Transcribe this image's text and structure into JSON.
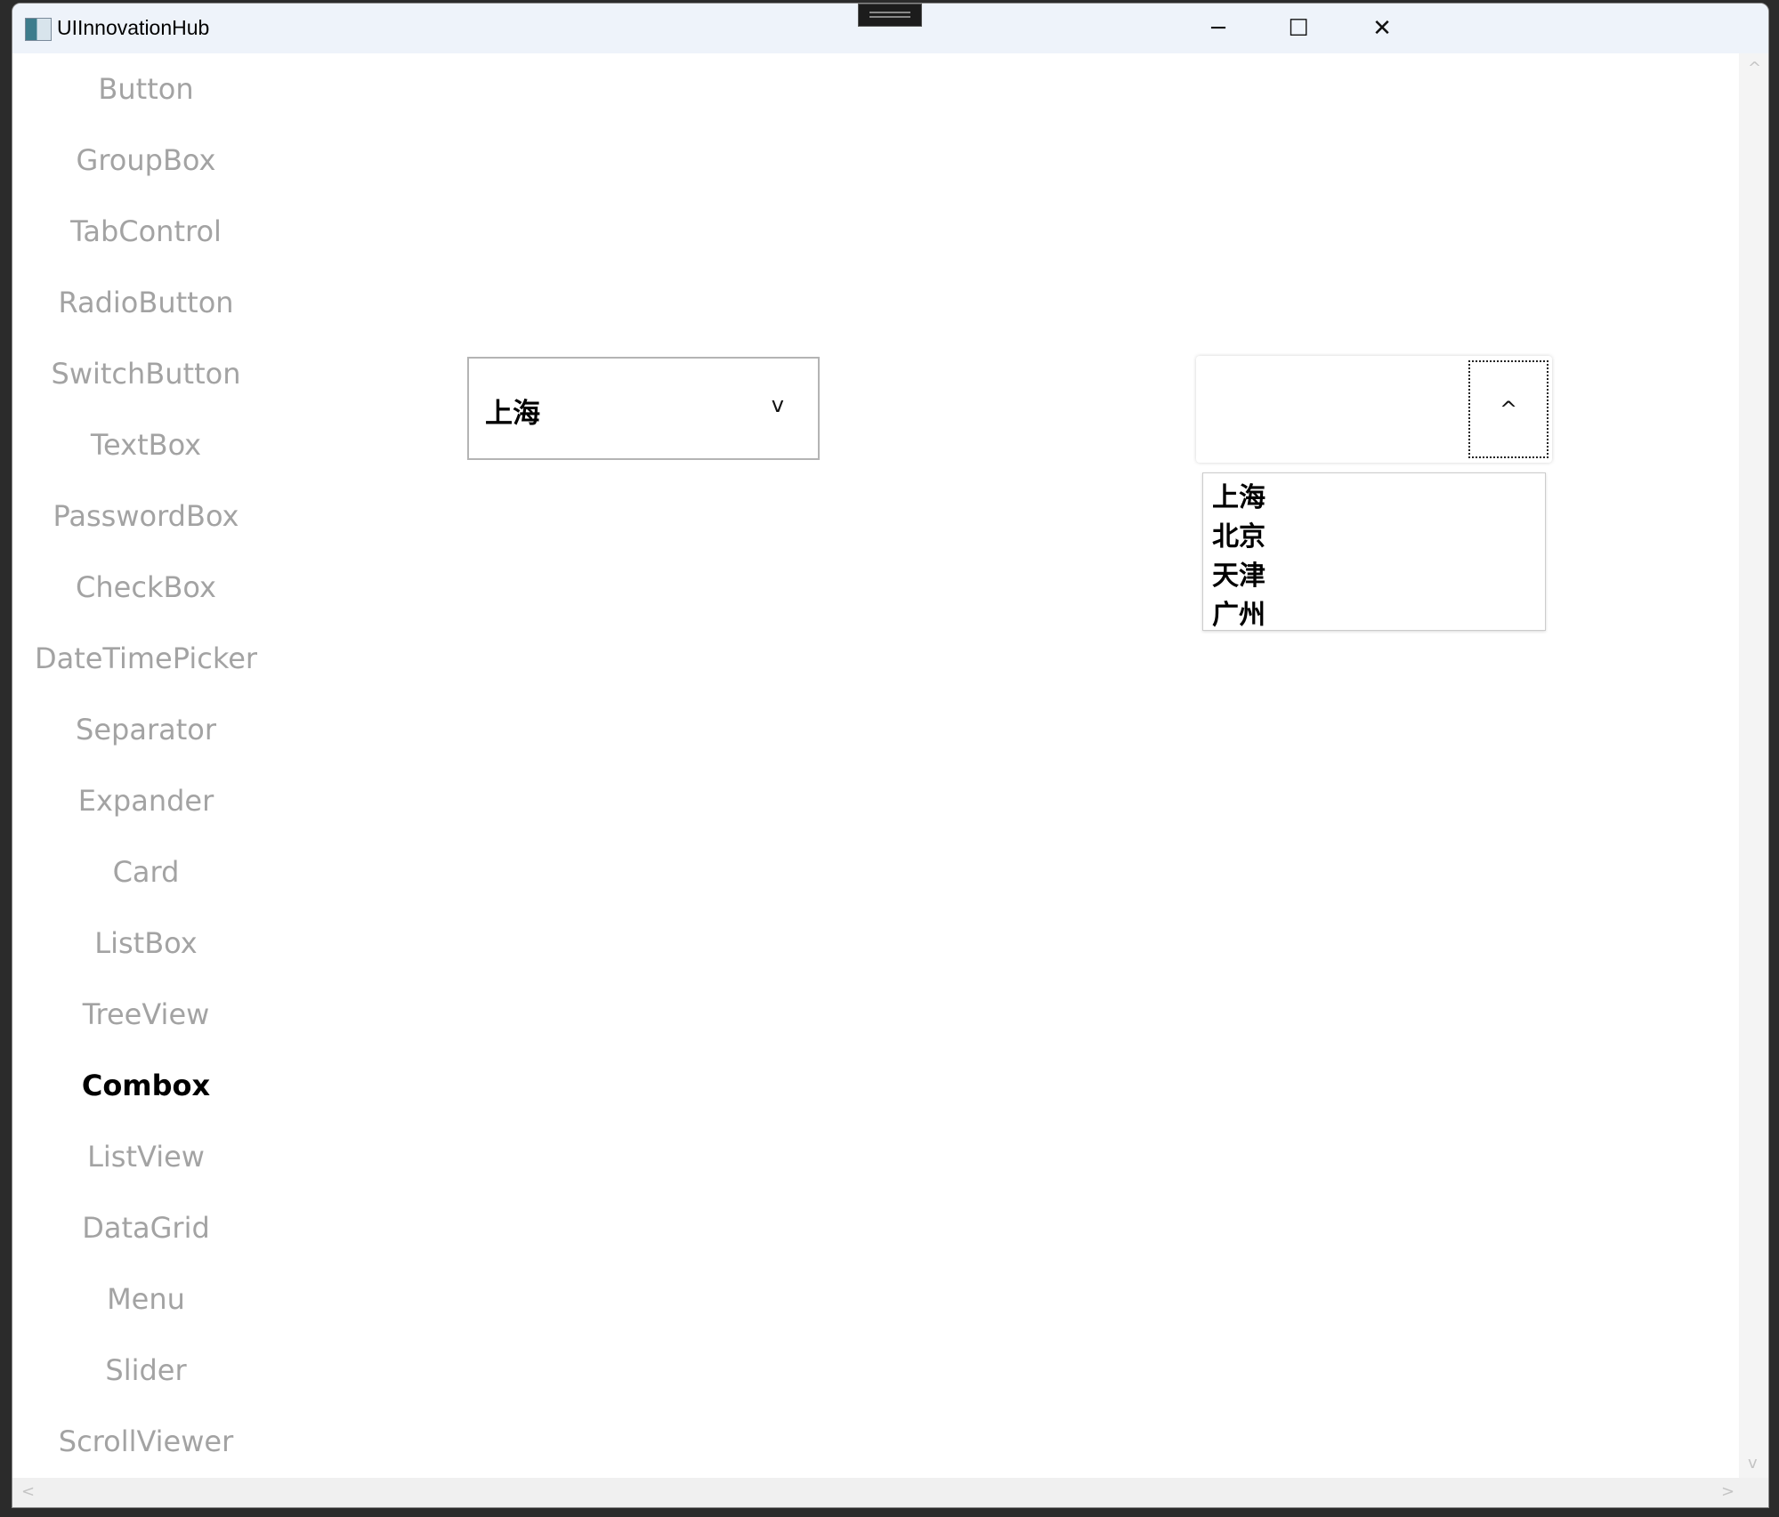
{
  "window": {
    "title": "UIInnovationHub",
    "minimize": "─",
    "maximize": "☐",
    "close": "✕"
  },
  "sidebar": {
    "items": [
      {
        "label": "Button"
      },
      {
        "label": "GroupBox"
      },
      {
        "label": "TabControl"
      },
      {
        "label": "RadioButton"
      },
      {
        "label": "SwitchButton"
      },
      {
        "label": "TextBox"
      },
      {
        "label": "PasswordBox"
      },
      {
        "label": "CheckBox"
      },
      {
        "label": "DateTimePicker"
      },
      {
        "label": "Separator"
      },
      {
        "label": "Expander"
      },
      {
        "label": "Card"
      },
      {
        "label": "ListBox"
      },
      {
        "label": "TreeView"
      },
      {
        "label": "Combox",
        "active": true
      },
      {
        "label": "ListView"
      },
      {
        "label": "DataGrid"
      },
      {
        "label": "Menu"
      },
      {
        "label": "Slider"
      },
      {
        "label": "ScrollViewer"
      }
    ]
  },
  "combo1": {
    "value": "上海",
    "arrow": "v"
  },
  "combo2": {
    "value": "",
    "arrow": "^",
    "options": [
      "上海",
      "北京",
      "天津",
      "广州"
    ]
  },
  "scroll": {
    "up": "^",
    "down": "v",
    "left": "<",
    "right": ">"
  }
}
